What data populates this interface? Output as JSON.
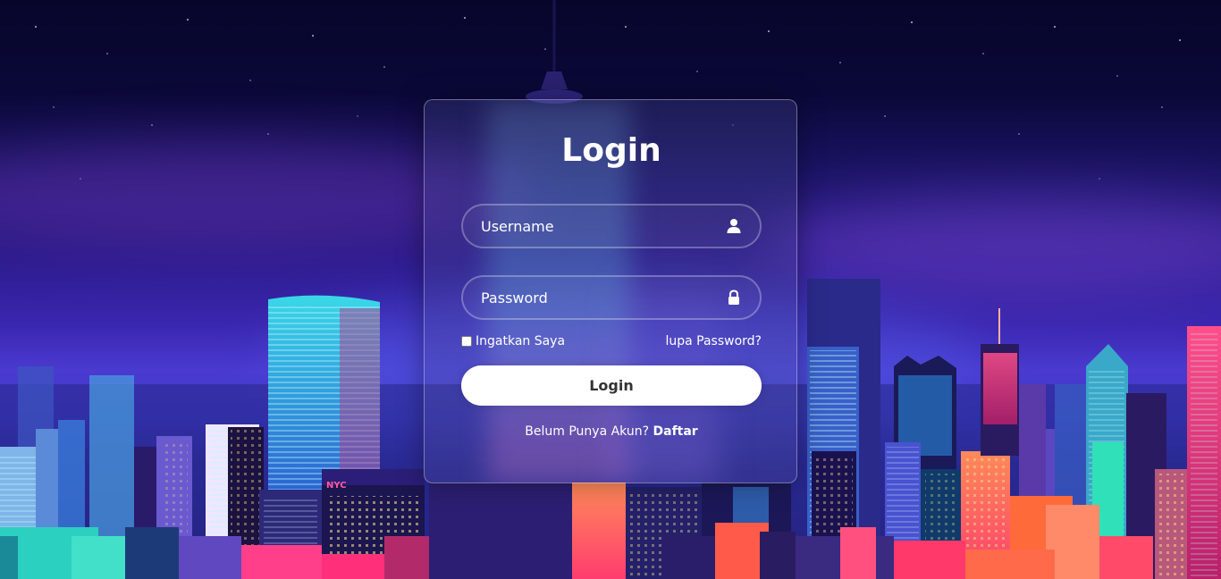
{
  "background": {
    "sign_text": "NYC",
    "sky_colors": [
      "#07062a",
      "#2a1a8a",
      "#4a3ad0"
    ]
  },
  "login": {
    "title": "Login",
    "username": {
      "placeholder": "Username",
      "icon": "user-icon"
    },
    "password": {
      "placeholder": "Password",
      "icon": "lock-icon"
    },
    "remember_label": "Ingatkan Saya",
    "forgot_label": "lupa Password?",
    "submit_label": "Login",
    "register_prompt": "Belum Punya Akun?",
    "register_link": "Daftar"
  }
}
